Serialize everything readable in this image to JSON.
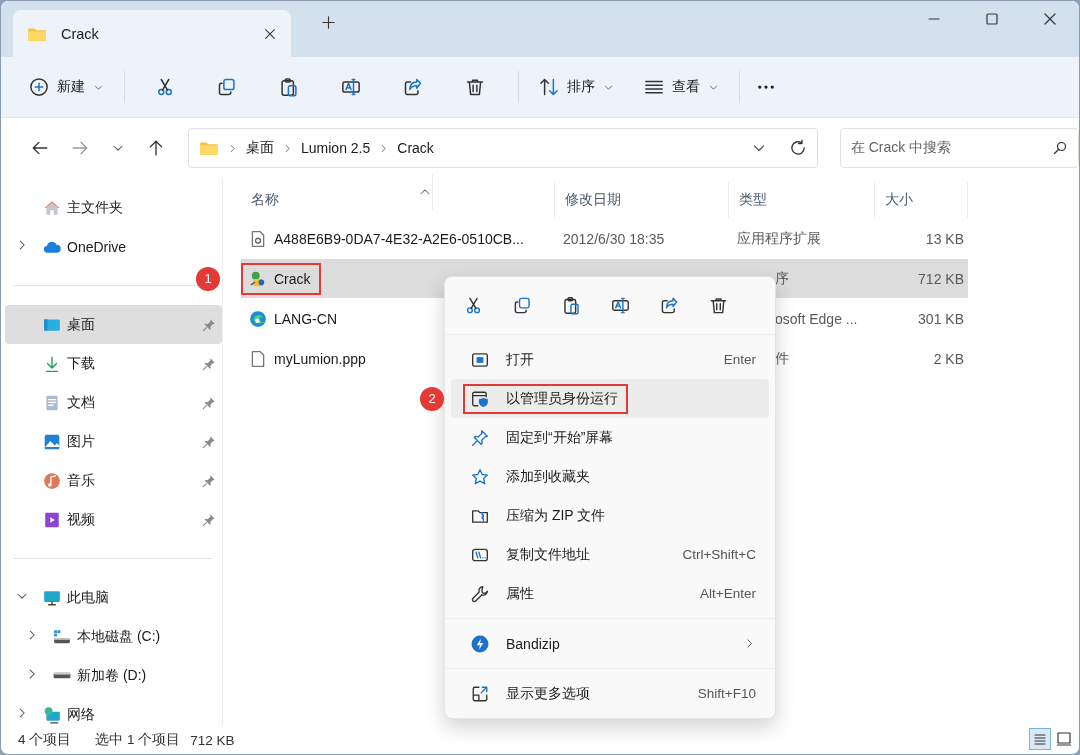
{
  "window": {
    "tab_title": "Crack"
  },
  "toolbar": {
    "new_label": "新建",
    "sort_label": "排序",
    "view_label": "查看"
  },
  "address": {
    "path": [
      "桌面",
      "Lumion 2.5",
      "Crack"
    ],
    "search_placeholder": "在 Crack 中搜索"
  },
  "sidebar": {
    "sections": [
      [
        {
          "label": "主文件夹",
          "selected": false
        },
        {
          "label": "OneDrive",
          "selected": false,
          "expanded": false
        }
      ],
      [
        {
          "label": "桌面",
          "selected": true,
          "pinned": true
        },
        {
          "label": "下载",
          "selected": false,
          "pinned": true
        },
        {
          "label": "文档",
          "selected": false,
          "pinned": true
        },
        {
          "label": "图片",
          "selected": false,
          "pinned": true
        },
        {
          "label": "音乐",
          "selected": false,
          "pinned": true
        },
        {
          "label": "视频",
          "selected": false,
          "pinned": true
        }
      ],
      [
        {
          "label": "此电脑",
          "selected": false,
          "expanded": true,
          "children": [
            {
              "label": "本地磁盘 (C:)",
              "selected": false,
              "expanded": false
            },
            {
              "label": "新加卷 (D:)",
              "selected": false,
              "expanded": false
            }
          ]
        },
        {
          "label": "网络",
          "selected": false,
          "expanded": false
        }
      ]
    ]
  },
  "table": {
    "columns": [
      "名称",
      "修改日期",
      "类型",
      "大小"
    ],
    "rows": [
      {
        "name": "A488E6B9-0DA7-4E32-A2E6-0510CB...",
        "date": "2012/6/30 18:35",
        "type": "应用程序扩展",
        "size": "13 KB",
        "selected": false
      },
      {
        "name": "Crack",
        "type": "序",
        "size": "712 KB",
        "selected": true,
        "badge": "1"
      },
      {
        "name": "LANG-CN",
        "type": "osoft Edge ...",
        "size": "301 KB",
        "selected": false
      },
      {
        "name": "myLumion.ppp",
        "type": "件",
        "size": "2 KB",
        "selected": false
      }
    ]
  },
  "context_menu": {
    "groups": [
      [
        {
          "label": "打开",
          "shortcut": "Enter",
          "highlighted": false
        },
        {
          "label": "以管理员身份运行",
          "highlighted": true,
          "badge": "2"
        },
        {
          "label": "固定到“开始”屏幕",
          "highlighted": false
        },
        {
          "label": "添加到收藏夹",
          "highlighted": false
        },
        {
          "label": "压缩为 ZIP 文件",
          "highlighted": false
        },
        {
          "label": "复制文件地址",
          "shortcut": "Ctrl+Shift+C",
          "highlighted": false
        },
        {
          "label": "属性",
          "shortcut": "Alt+Enter",
          "highlighted": false
        }
      ],
      [
        {
          "label": "Bandizip",
          "submenu": true,
          "highlighted": false
        }
      ],
      [
        {
          "label": "显示更多选项",
          "shortcut": "Shift+F10",
          "highlighted": false
        }
      ]
    ]
  },
  "status_bar": {
    "item_count": "4 个项目",
    "selection": "选中 1 个项目",
    "selection_size": "712 KB"
  },
  "view_buttons": [
    {
      "selected": true
    },
    {
      "selected": false
    }
  ]
}
